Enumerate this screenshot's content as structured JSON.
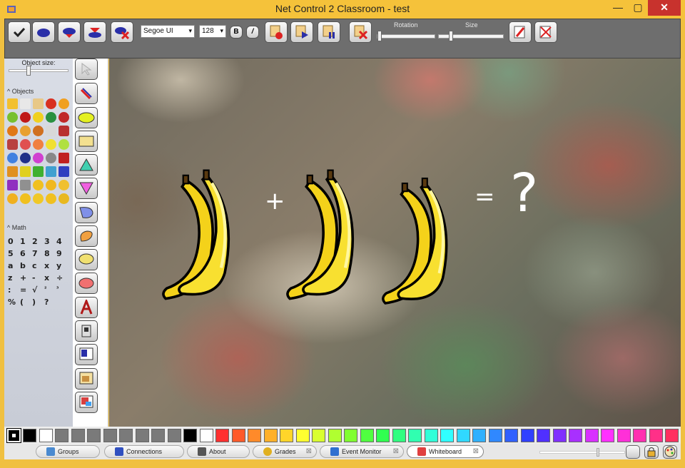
{
  "window": {
    "title": "Net Control 2 Classroom - test",
    "min": "—",
    "max": "▢",
    "close": "✕"
  },
  "toolbar": {
    "font_name": "Segoe UI",
    "font_size": "128",
    "bold_label": "B",
    "italic_label": "/",
    "rotation_label": "Rotation",
    "size_label": "Size",
    "rotation_value": 0.0,
    "size_value": 0.2
  },
  "left_panel": {
    "object_size_label": "Object size:",
    "objects_section": "Objects",
    "math_section": "Math",
    "object_size_value": 0.4,
    "math_symbols": [
      "0",
      "1",
      "2",
      "3",
      "4",
      "5",
      "6",
      "7",
      "8",
      "9",
      "a",
      "b",
      "c",
      "x",
      "y",
      "z",
      "+",
      "-",
      "x",
      "÷",
      ":",
      "=",
      "√",
      "²",
      "³",
      "%",
      "(",
      ")",
      "?"
    ]
  },
  "canvas": {
    "plus": "+",
    "equals": "=",
    "question": "?"
  },
  "colors": {
    "palette": [
      "#000000",
      "#ffffff",
      "#7a7a7a",
      "#7a7a7a",
      "#7a7a7a",
      "#7a7a7a",
      "#7a7a7a",
      "#7a7a7a",
      "#7a7a7a",
      "#7a7a7a",
      "#000000",
      "#ffffff",
      "#ff3030",
      "#ff5a2a",
      "#ff8a2a",
      "#ffb02a",
      "#ffd52a",
      "#ffff30",
      "#d9ff30",
      "#b0ff30",
      "#80ff30",
      "#50ff40",
      "#30ff50",
      "#30ff80",
      "#30ffb0",
      "#30ffd8",
      "#30ffff",
      "#30d8ff",
      "#30b0ff",
      "#3088ff",
      "#3060ff",
      "#3040ff",
      "#5030ff",
      "#8030ff",
      "#a830ff",
      "#d830ff",
      "#ff30ff",
      "#ff30d8",
      "#ff30b0",
      "#ff3088",
      "#ff3060"
    ]
  },
  "tabs": [
    {
      "label": "Groups",
      "closable": false,
      "active": false
    },
    {
      "label": "Connections",
      "closable": false,
      "active": false
    },
    {
      "label": "About",
      "closable": false,
      "active": false
    },
    {
      "label": "Grades",
      "closable": true,
      "active": false
    },
    {
      "label": "Event Monitor",
      "closable": true,
      "active": false
    },
    {
      "label": "Whiteboard",
      "closable": true,
      "active": true
    }
  ]
}
